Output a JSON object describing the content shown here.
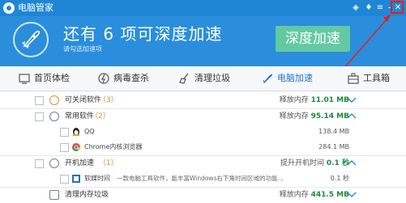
{
  "window": {
    "title": "电脑管家"
  },
  "header": {
    "headline": "还有 6 项可深度加速",
    "subline": "请勾选加速项",
    "button": "深度加速"
  },
  "tabs": [
    {
      "label": "首页体检",
      "icon": "home-icon"
    },
    {
      "label": "病毒查杀",
      "icon": "virus-scan-icon"
    },
    {
      "label": "清理垃圾",
      "icon": "broom-icon"
    },
    {
      "label": "电脑加速",
      "icon": "rocket-icon",
      "active": true
    },
    {
      "label": "工具箱",
      "icon": "toolbox-icon"
    }
  ],
  "rows": [
    {
      "label": "可关闭软件",
      "count": "（3）",
      "value_prefix": "释放内存",
      "value": "11.01 MB",
      "expanded": false
    },
    {
      "label": "常用软件",
      "count": "（2）",
      "value_prefix": "释放内存",
      "value": "95.14 MB",
      "expanded": true
    },
    {
      "label": "QQ",
      "value": "138.4 MB"
    },
    {
      "label": "Chrome内核浏览器",
      "value": "284.1 MB"
    },
    {
      "label": "开机加速",
      "count": "（1）",
      "value_prefix": "提升开机时间",
      "value": "0.1 秒",
      "expanded": true
    },
    {
      "label": "软媒时间",
      "desc": "一款电脑工具软件，能丰富Windows右下角时间区域的功能...",
      "value": "0.1 秒"
    },
    {
      "label": "清理内存垃圾",
      "value_prefix": "释放内存",
      "value": "441.5 MB"
    }
  ],
  "colors": {
    "primary": "#2a8edc",
    "titlebar": "#1f86d6",
    "accent_green": "#62c9a2",
    "value_green": "#1c8a3e",
    "highlight_red": "#e02020"
  }
}
